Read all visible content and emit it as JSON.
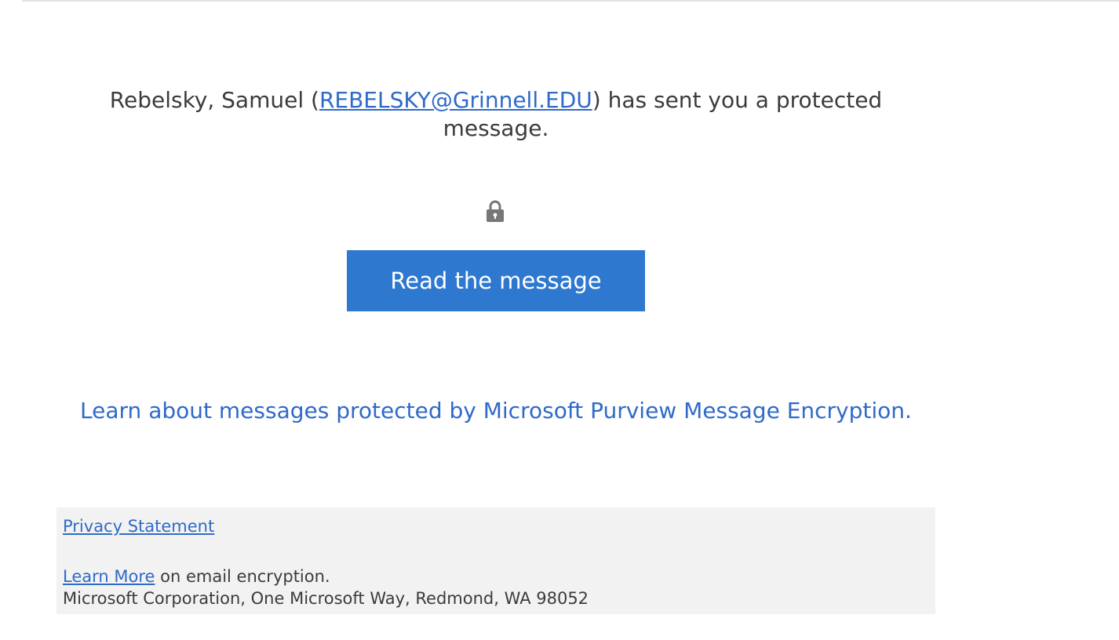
{
  "message": {
    "sender_name": "Rebelsky, Samuel (",
    "sender_email": "REBELSKY@Grinnell.EDU",
    "sent_text": ") has sent you a protected message."
  },
  "icons": {
    "lock": "lock-icon"
  },
  "actions": {
    "read_button": "Read the message"
  },
  "learn_about": {
    "text": "Learn about messages protected by Microsoft Purview Message Encryption."
  },
  "footer": {
    "privacy_statement": "Privacy Statement",
    "learn_more": "Learn More",
    "learn_more_suffix": " on email encryption.",
    "address": "Microsoft Corporation, One Microsoft Way, Redmond, WA 98052"
  },
  "colors": {
    "button": "#2f78d0",
    "link": "#2f6ac8",
    "footer_background": "#f2f2f2",
    "text": "#3b3b3b"
  }
}
